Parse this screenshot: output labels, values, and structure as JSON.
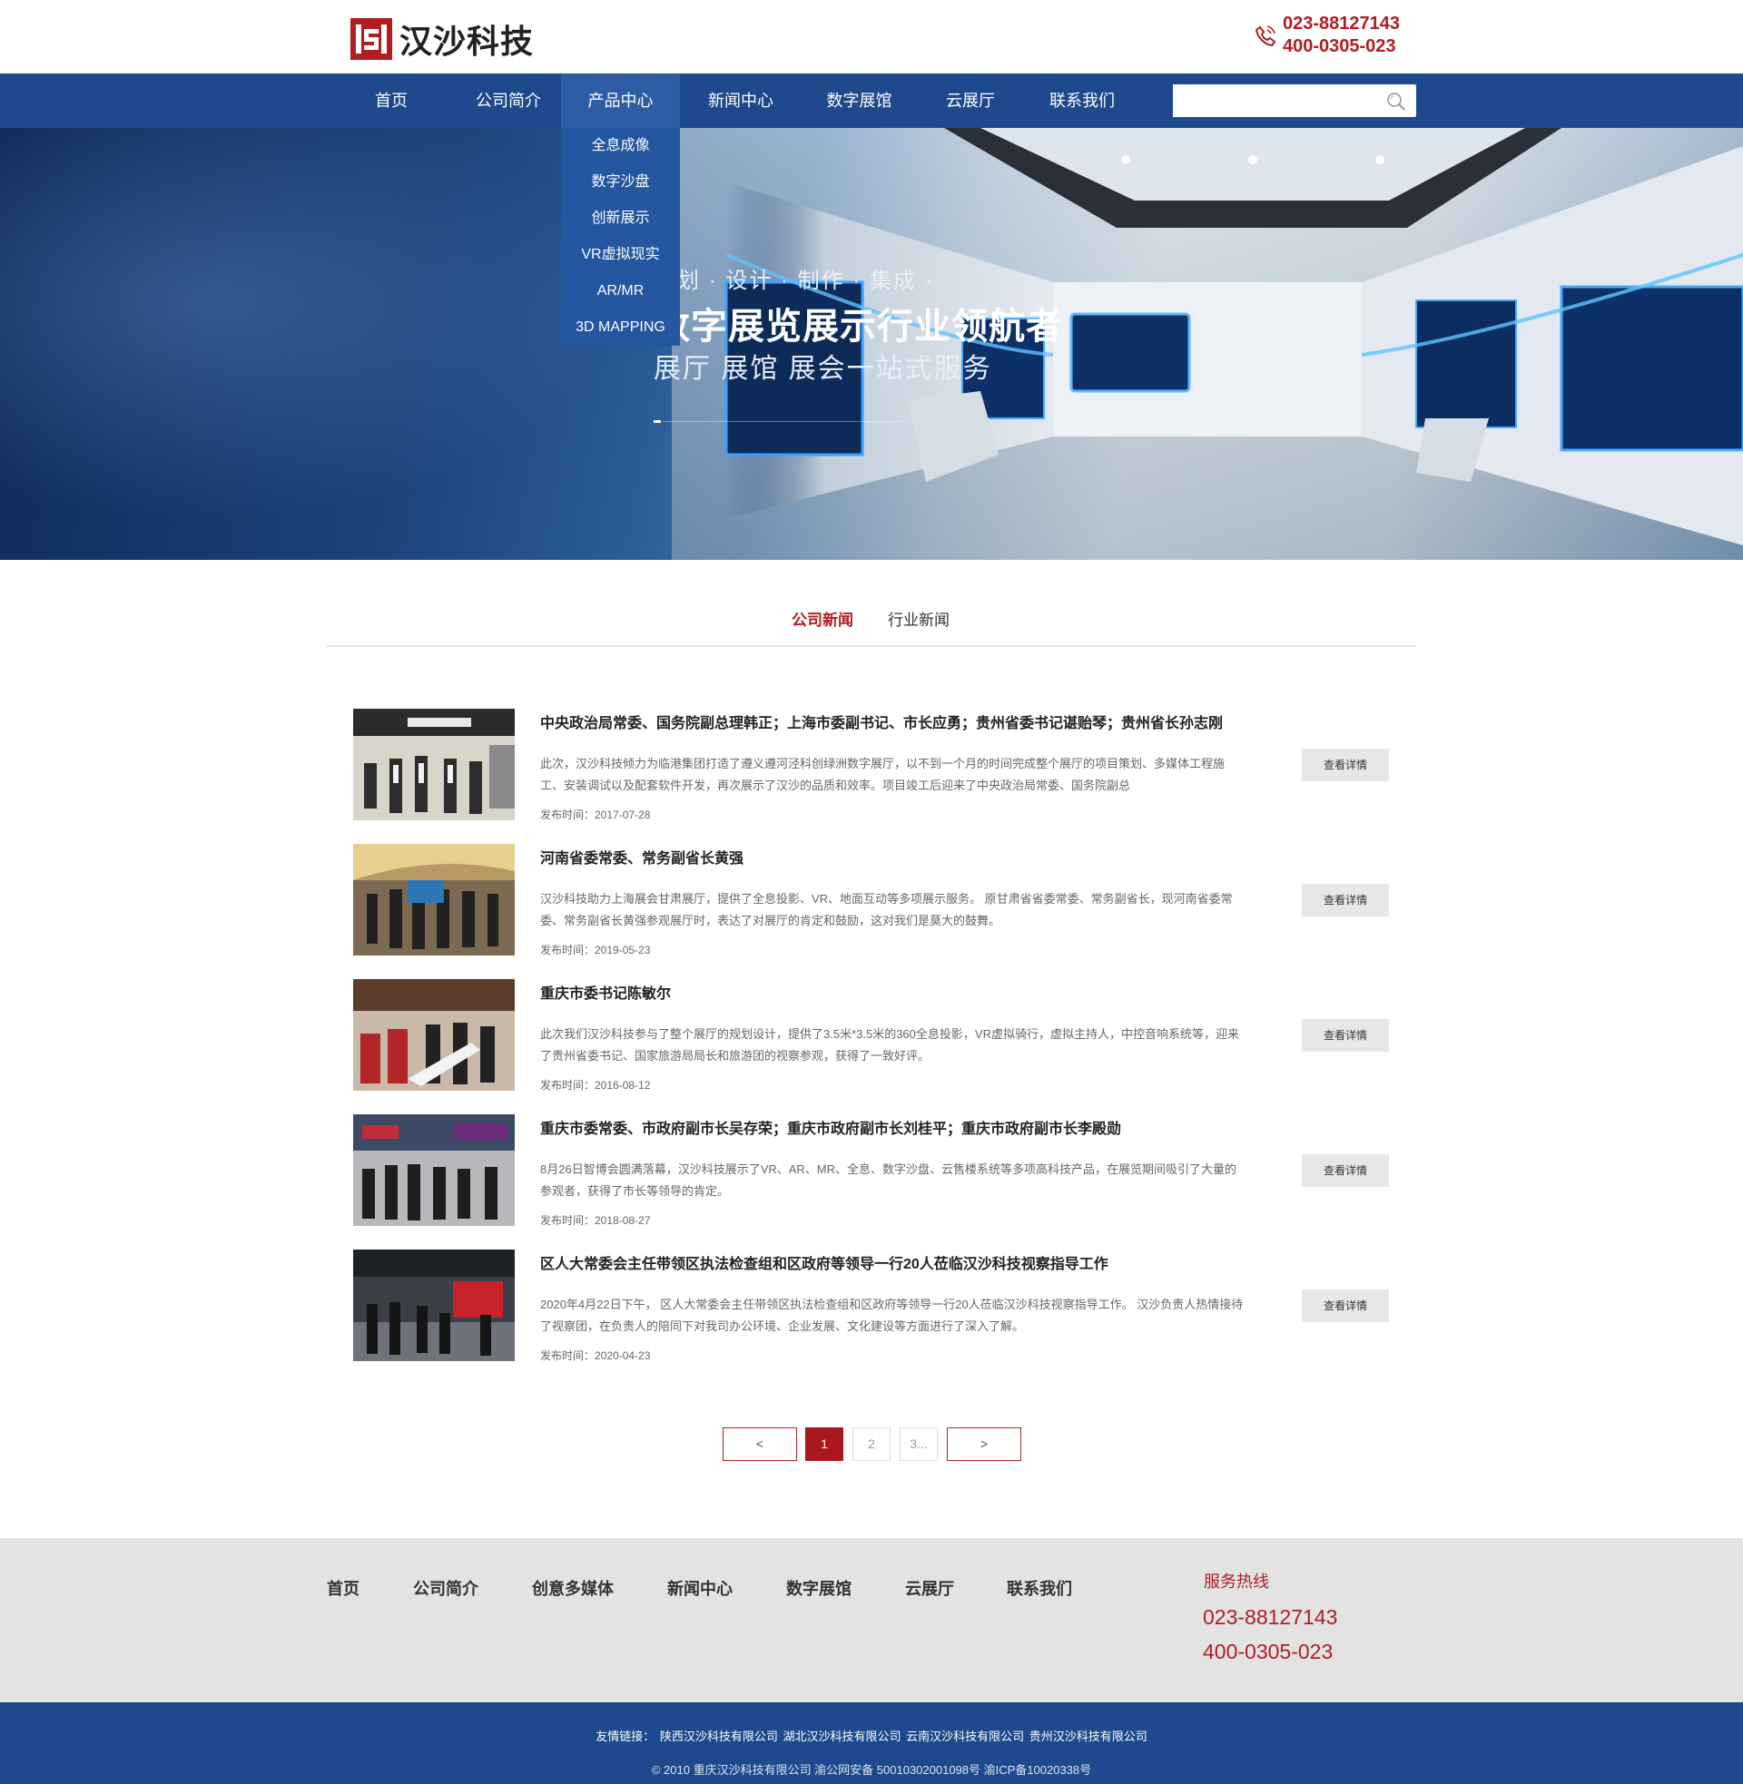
{
  "header": {
    "logo_text": "汉沙科技",
    "phone1": "023-88127143",
    "phone2": "400-0305-023",
    "brand_color": "#b01e23"
  },
  "nav": {
    "items": [
      "首页",
      "公司简介",
      "产品中心",
      "新闻中心",
      "数字展馆",
      "云展厅",
      "联系我们"
    ],
    "active": "产品中心",
    "dropdown": [
      "全息成像",
      "数字沙盘",
      "创新展示",
      "VR虚拟现实",
      "AR/MR",
      "3D MAPPING"
    ],
    "search_placeholder": "",
    "color": "#1e4a8d"
  },
  "banner": {
    "line1": "策划 · 设计 · 制作 · 集成 · ",
    "line2": "数字展览展示行业领航者",
    "line3": "展厅  展馆  展会一站式服务"
  },
  "tabs": {
    "company": "公司新闻",
    "industry": "行业新闻",
    "active": "公司新闻"
  },
  "news": [
    {
      "title": "中央政治局常委、国务院副总理韩正；上海市委副书记、市长应勇；贵州省委书记谌贻琴；贵州省长孙志刚",
      "desc": "此次，汉沙科技倾力为临港集团打造了遵义遵河泾科创绿洲数字展厅，以不到一个月的时间完成整个展厅的项目策划、多媒体工程施工、安装调试以及配套软件开发，再次展示了汉沙的品质和效率。项目竣工后迎来了中央政治局常委、国务院副总",
      "date": "发布时间：2017-07-28",
      "more": "查看详情"
    },
    {
      "title": "河南省委常委、常务副省长黄强",
      "desc": "汉沙科技助力上海展会甘肃展厅，提供了全息投影、VR、地面互动等多项展示服务。 原甘肃省省委常委、常务副省长，现河南省委常委、常务副省长黄强参观展厅时，表达了对展厅的肯定和鼓励，这对我们是莫大的鼓舞。",
      "date": "发布时间：2019-05-23",
      "more": "查看详情"
    },
    {
      "title": "重庆市委书记陈敏尔",
      "desc": "此次我们汉沙科技参与了整个展厅的规划设计，提供了3.5米*3.5米的360全息投影，VR虚拟骑行，虚拟主持人，中控音响系统等，迎来了贵州省委书记、国家旅游局局长和旅游团的视察参观，获得了一致好评。",
      "date": "发布时间：2016-08-12",
      "more": "查看详情"
    },
    {
      "title": "重庆市委常委、市政府副市长吴存荣；重庆市政府副市长刘桂平；重庆市政府副市长李殿勋",
      "desc": "8月26日智博会圆满落幕，汉沙科技展示了VR、AR、MR、全息、数字沙盘、云售楼系统等多项高科技产品，在展览期间吸引了大量的参观者，获得了市长等领导的肯定。",
      "date": "发布时间：2018-08-27",
      "more": "查看详情"
    },
    {
      "title": "区人大常委会主任带领区执法检查组和区政府等领导一行20人莅临汉沙科技视察指导工作",
      "desc": "2020年4月22日下午， 区人大常委会主任带领区执法检查组和区政府等领导一行20人莅临汉沙科技视察指导工作。 汉沙负责人热情接待了视察团，在负责人的陪同下对我司办公环境、企业发展、文化建设等方面进行了深入了解。",
      "date": "发布时间：2020-04-23",
      "more": "查看详情"
    }
  ],
  "pager": {
    "prev": "<",
    "pages": [
      "1",
      "2",
      "3..."
    ],
    "current": "1",
    "next": ">"
  },
  "footer": {
    "nav": [
      "首页",
      "公司简介",
      "创意多媒体",
      "新闻中心",
      "数字展馆",
      "云展厅",
      "联系我们"
    ],
    "hotline_label": "服务热线",
    "hotline1": "023-88127143",
    "hotline2": "400-0305-023",
    "links_label": "友情链接：",
    "links": [
      "陕西汉沙科技有限公司",
      "湖北汉沙科技有限公司",
      "云南汉沙科技有限公司",
      "贵州汉沙科技有限公司"
    ],
    "copyright": "© 2010 重庆汉沙科技有限公司  渝公网安备 50010302001098号 渝ICP备10020338号"
  }
}
